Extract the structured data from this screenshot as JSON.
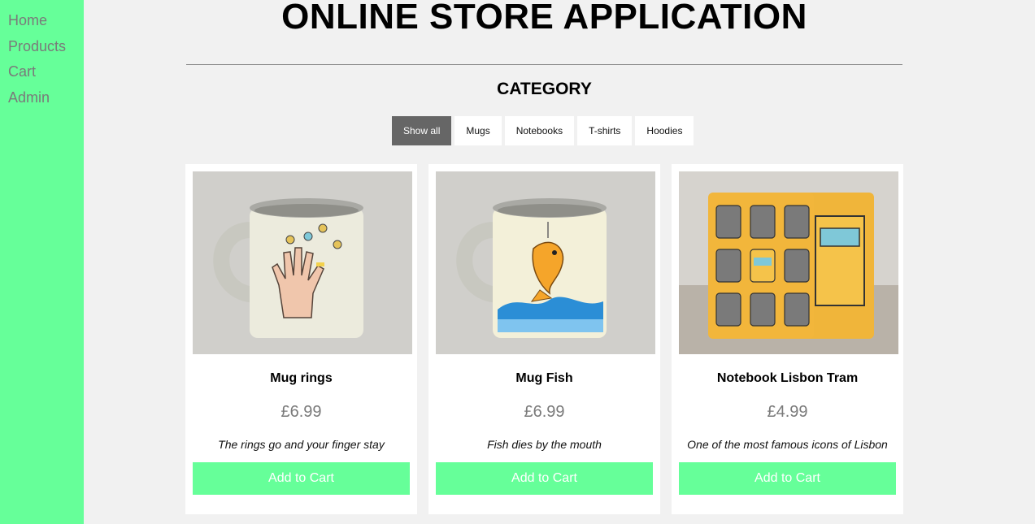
{
  "sidebar": {
    "items": [
      {
        "label": "Home"
      },
      {
        "label": "Products"
      },
      {
        "label": "Cart"
      },
      {
        "label": "Admin"
      }
    ]
  },
  "header": {
    "title": "ONLINE STORE APPLICATION"
  },
  "category": {
    "heading": "CATEGORY",
    "filters": [
      "Show all",
      "Mugs",
      "Notebooks",
      "T-shirts",
      "Hoodies"
    ],
    "active_filter": "Show all"
  },
  "products": [
    {
      "name": "Mug rings",
      "price": "£6.99",
      "description": "The rings go and your finger stay",
      "button_label": "Add to Cart"
    },
    {
      "name": "Mug Fish",
      "price": "£6.99",
      "description": "Fish dies by the mouth",
      "button_label": "Add to Cart"
    },
    {
      "name": "Notebook Lisbon Tram",
      "price": "£4.99",
      "description": "One of the most famous icons of Lisbon",
      "button_label": "Add to Cart"
    }
  ],
  "colors": {
    "sidebar": "#66ff99",
    "accent_button": "#66ff99",
    "active_filter": "#666666",
    "background": "#f1f1f1"
  }
}
